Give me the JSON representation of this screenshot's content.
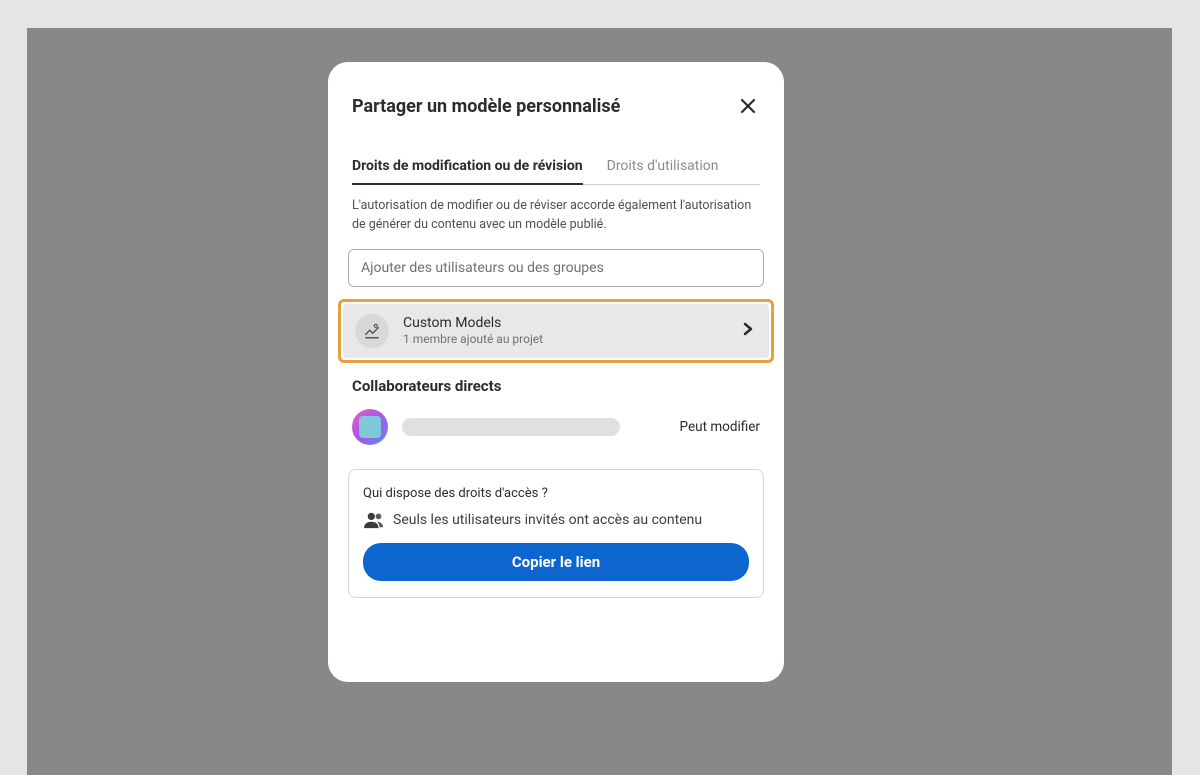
{
  "modal": {
    "title": "Partager un modèle personnalisé",
    "tabs": {
      "editReview": "Droits de modification ou de révision",
      "usage": "Droits d'utilisation"
    },
    "description": "L'autorisation de modifier ou de réviser accorde également l'autorisation de générer du contenu avec un modèle publié.",
    "addPlaceholder": "Ajouter des utilisateurs ou des groupes",
    "project": {
      "name": "Custom Models",
      "subtitle": "1 membre ajouté au projet"
    },
    "collaborators": {
      "title": "Collaborateurs directs",
      "permission": "Peut modifier"
    },
    "access": {
      "question": "Qui dispose des droits d'accès ?",
      "info": "Seuls les utilisateurs invités ont accès au contenu",
      "copyButton": "Copier le lien"
    }
  }
}
